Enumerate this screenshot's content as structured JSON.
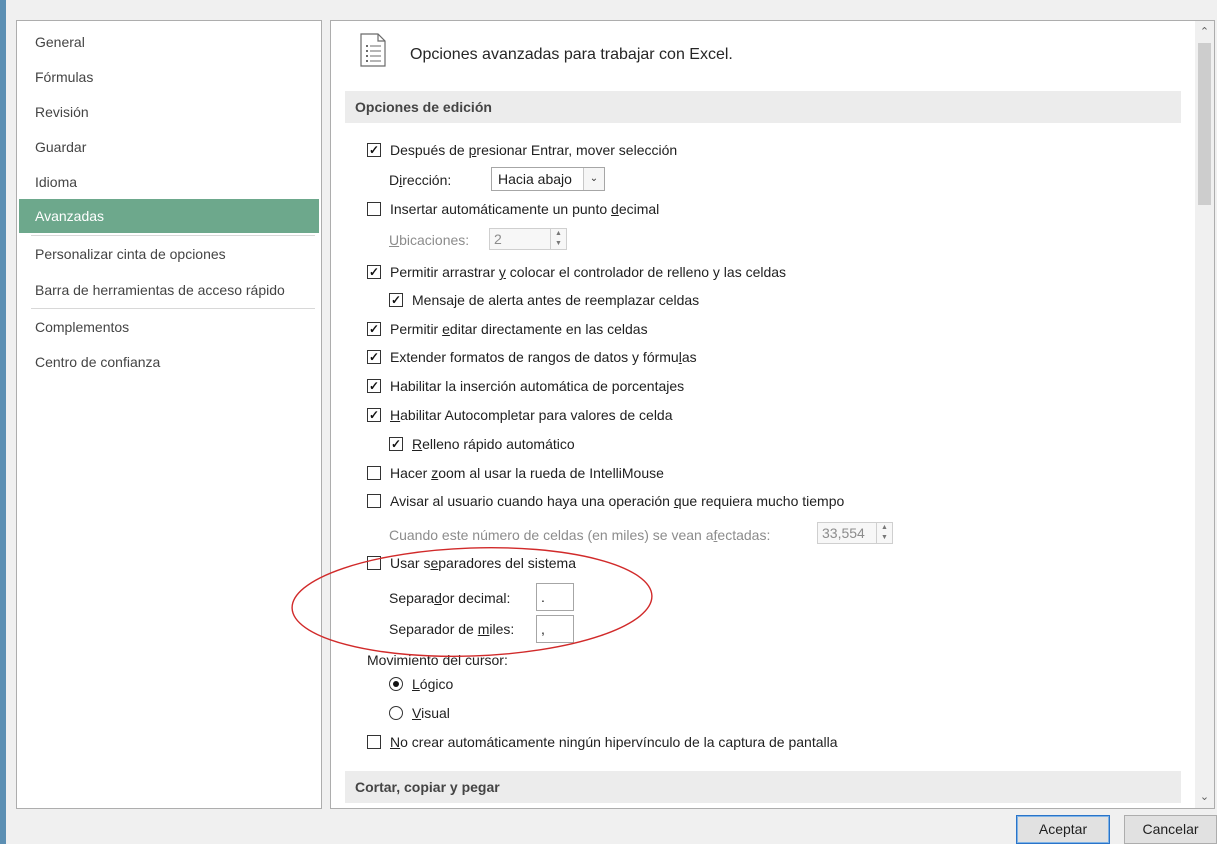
{
  "nav": {
    "items": [
      {
        "label": "General"
      },
      {
        "label": "Fórmulas"
      },
      {
        "label": "Revisión"
      },
      {
        "label": "Guardar"
      },
      {
        "label": "Idioma"
      },
      {
        "label": "Avanzadas",
        "selected": true
      },
      {
        "label": "Personalizar cinta de opciones"
      },
      {
        "label": "Barra de herramientas de acceso rápido"
      },
      {
        "label": "Complementos"
      },
      {
        "label": "Centro de confianza"
      }
    ]
  },
  "header": {
    "title": "Opciones avanzadas para trabajar con Excel.",
    "icon": "document-list-icon"
  },
  "sections": {
    "edit": "Opciones de edición",
    "cut": "Cortar, copiar y pegar"
  },
  "options": {
    "after_enter": {
      "pre": "Después de ",
      "u": "p",
      "post": "resionar Entrar, mover selección",
      "checked": true
    },
    "direction_label": {
      "pre": "D",
      "u": "i",
      "post": "rección:"
    },
    "direction_value": "Hacia abajo",
    "auto_decimal": {
      "pre": "Insertar automáticamente un punto ",
      "u": "d",
      "post": "ecimal",
      "checked": false
    },
    "places_label": {
      "pre": "",
      "u": "U",
      "post": "bicaciones:"
    },
    "places_value": "2",
    "drag_fill": {
      "pre": "Permitir arrastrar ",
      "u": "y",
      "post": " colocar el controlador de relleno y las celdas",
      "checked": true
    },
    "alert_replace": {
      "pre": "Mensaje de alerta antes de reemplazar celdas",
      "u": "",
      "post": "",
      "checked": true
    },
    "edit_direct": {
      "pre": "Permitir ",
      "u": "e",
      "post": "ditar directamente en las celdas",
      "checked": true
    },
    "extend_formats": {
      "pre": "Extender formatos de rangos de datos y fórmu",
      "u": "l",
      "post": "as",
      "checked": true
    },
    "auto_percent": {
      "pre": "Habilitar la inserción automática de porcentajes",
      "u": "",
      "post": "",
      "checked": true
    },
    "autocomplete": {
      "pre": "",
      "u": "H",
      "post": "abilitar Autocompletar para valores de celda",
      "checked": true
    },
    "flash_fill": {
      "pre": "",
      "u": "R",
      "post": "elleno rápido automático",
      "checked": true
    },
    "zoom_roll": {
      "pre": "Hacer ",
      "u": "z",
      "post": "oom al usar la rueda de IntelliMouse",
      "checked": false
    },
    "alert_long": {
      "pre": "Avisar al usuario cuando haya una operación ",
      "u": "q",
      "post": "ue requiera mucho tiempo",
      "checked": false
    },
    "cells_affected_label": {
      "pre": "Cuando este número de celdas (en miles) se vean a",
      "u": "f",
      "post": "ectadas:"
    },
    "cells_affected_value": "33,554",
    "system_separators": {
      "pre": "Usar s",
      "u": "e",
      "post": "paradores del sistema",
      "checked": false
    },
    "decimal_sep_label": {
      "pre": "Separa",
      "u": "d",
      "post": "or decimal:"
    },
    "decimal_sep_value": ".",
    "thousands_sep_label": {
      "pre": "Separador de ",
      "u": "m",
      "post": "iles:"
    },
    "thousands_sep_value": ",",
    "cursor_movement": "Movimiento del cursor:",
    "logical": {
      "pre": "",
      "u": "L",
      "post": "ógico",
      "selected": true
    },
    "visual": {
      "pre": "",
      "u": "V",
      "post": "isual",
      "selected": false
    },
    "no_hyperlink": {
      "pre": "",
      "u": "N",
      "post": "o crear automáticamente ningún hipervínculo de la captura de pantalla",
      "checked": false
    }
  },
  "buttons": {
    "ok": "Aceptar",
    "cancel": "Cancelar"
  },
  "colors": {
    "nav_selected": "#6da88c",
    "annotation": "#d12a2a",
    "default_button_border": "#2a74c9"
  },
  "scrollbar": {
    "up_icon": "scroll-up-icon",
    "down_icon": "scroll-down-icon"
  }
}
